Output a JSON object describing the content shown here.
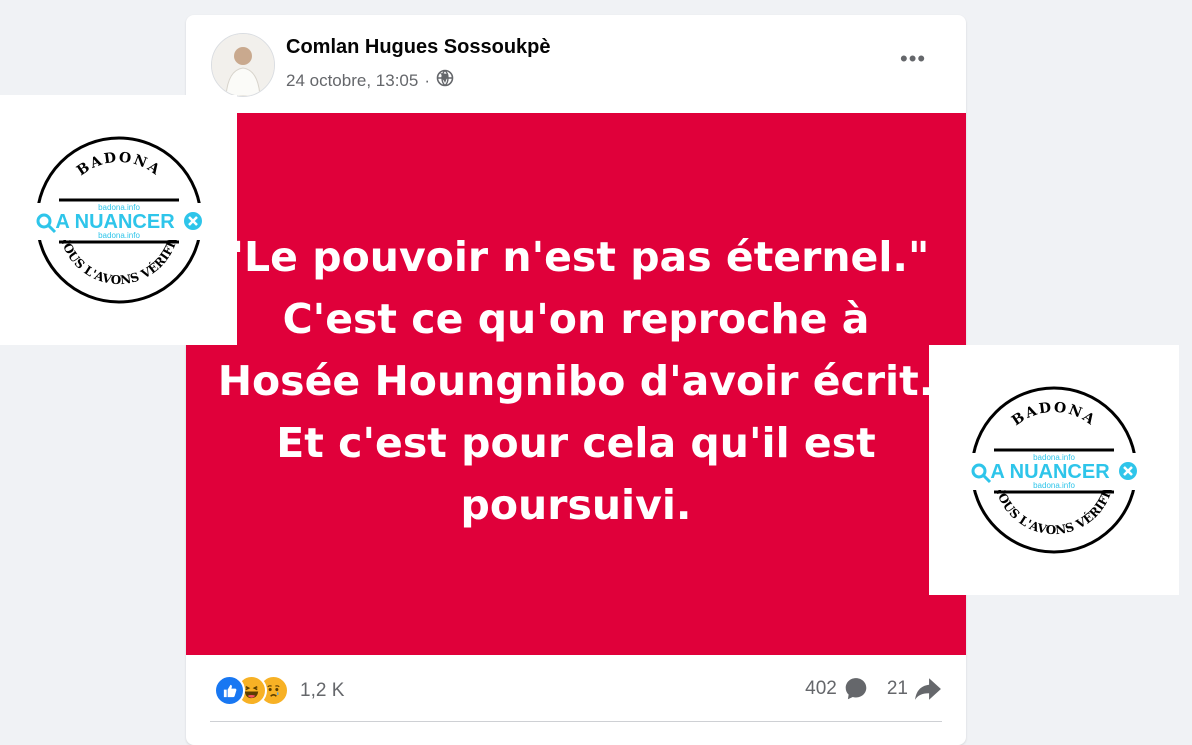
{
  "post": {
    "author": "Comlan Hugues Sossoukpè",
    "date": "24 octobre, 13:05",
    "separator": "·",
    "privacy_icon": "globe-icon",
    "more_label": "•••",
    "text": "\"Le pouvoir n'est pas éternel.\" C'est ce qu'on reproche à Hosée Houngnibo d'avoir écrit. Et c'est pour cela qu'il est poursuivi.",
    "background_color": "#e0003a"
  },
  "footer": {
    "reactions": [
      "like-icon",
      "haha-icon",
      "sad-icon"
    ],
    "reaction_count": "1,2 K",
    "comment_count": "402",
    "share_count": "21"
  },
  "stamps": {
    "brand": "BADONA",
    "label": "A NUANCER",
    "site": "badona.info",
    "motto": "NOUS L'AVONS VÉRIFIÉ"
  },
  "colors": {
    "brand_cyan": "#2ec5ea",
    "facebook_blue": "#1877f2",
    "muted": "#65676b"
  }
}
